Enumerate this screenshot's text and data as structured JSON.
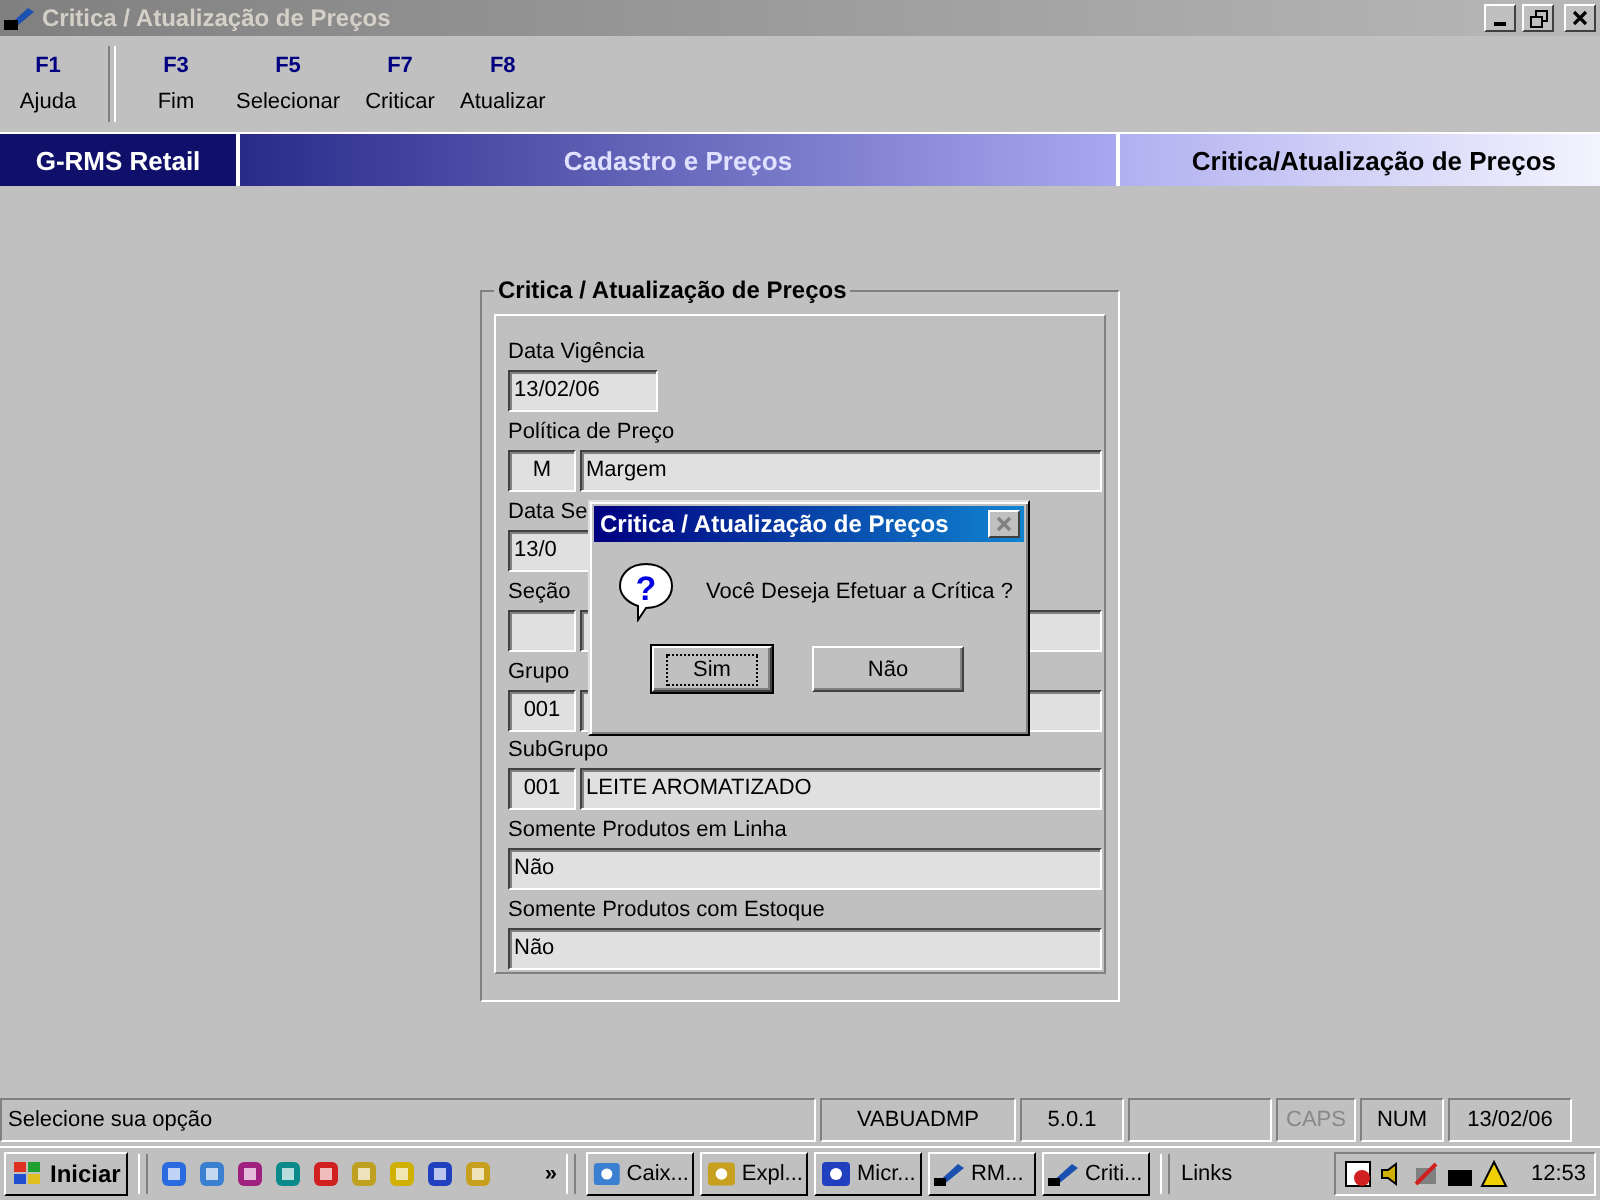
{
  "window": {
    "title": "Critica / Atualização de Preços"
  },
  "toolbar": [
    {
      "key": "F1",
      "label": "Ajuda"
    },
    {
      "key": "F3",
      "label": "Fim"
    },
    {
      "key": "F5",
      "label": "Selecionar"
    },
    {
      "key": "F7",
      "label": "Criticar"
    },
    {
      "key": "F8",
      "label": "Atualizar"
    }
  ],
  "banner": {
    "product": "G-RMS Retail",
    "module": "Cadastro e Preços",
    "screen": "Critica/Atualização de Preços"
  },
  "form": {
    "title": "Critica / Atualização de Preços",
    "fields": [
      {
        "kind": "date",
        "label": "Data Vigência",
        "value": "13/02/06"
      },
      {
        "kind": "pair",
        "label": "Política de Preço",
        "code": "M",
        "description": "Margem"
      },
      {
        "kind": "date",
        "label": "Data Se",
        "value": "13/0"
      },
      {
        "kind": "pair",
        "label": "Seção"
      },
      {
        "kind": "pair",
        "label": "Grupo",
        "code": "001"
      },
      {
        "kind": "pair",
        "label": "SubGrupo",
        "code": "001",
        "description": "LEITE AROMATIZADO"
      },
      {
        "kind": "text",
        "label": "Somente Produtos em Linha",
        "value": "Não"
      },
      {
        "kind": "text",
        "label": "Somente Produtos com Estoque",
        "value": "Não"
      }
    ]
  },
  "dialog": {
    "title": "Critica / Atualização de Preços",
    "icon": "?",
    "message": "Você Deseja Efetuar a Crítica ?",
    "buttons": [
      {
        "label": "Sim",
        "default": true
      },
      {
        "label": "Não",
        "default": false
      }
    ]
  },
  "status_bar": [
    {
      "text": "Selecione sua opção",
      "disabled": false
    },
    {
      "text": "VABUADMP",
      "disabled": false
    },
    {
      "text": "5.0.1",
      "disabled": false
    },
    {
      "text": "CAPS",
      "disabled": true
    },
    {
      "text": "NUM",
      "disabled": false
    },
    {
      "text": "13/02/06",
      "disabled": false
    }
  ],
  "taskbar": {
    "start": "Iniciar",
    "more": "»",
    "tasks": [
      "Caix...",
      "Expl...",
      "Micr...",
      "RM...",
      "Criti..."
    ],
    "links": "Links",
    "clock": "12:53"
  }
}
